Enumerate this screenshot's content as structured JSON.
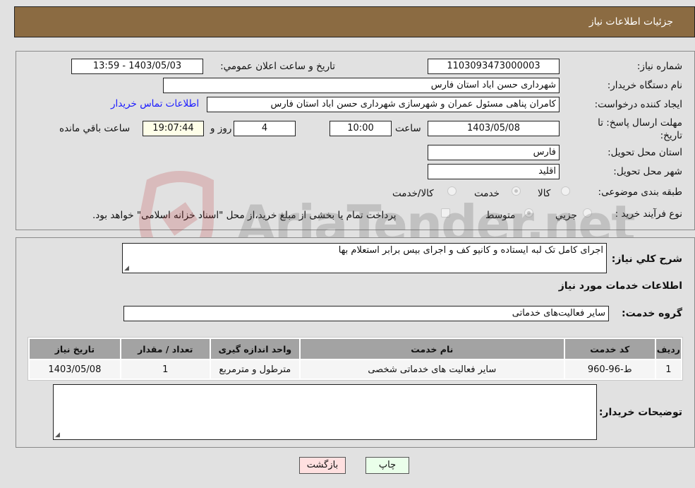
{
  "header": {
    "title": "جزئيات اطلاعات نياز"
  },
  "form": {
    "need_number_label": "شماره نياز:",
    "need_number": "1103093473000003",
    "announce_label": "تاريخ و ساعت اعلان عمومي:",
    "announce_value": "1403/05/03 - 13:59",
    "buyer_org_label": "نام دستگاه خريدار:",
    "buyer_org": "شهرداری حسن اباد استان فارس",
    "creator_label": "ايجاد کننده درخواست:",
    "creator": "کامران پناهی مسئول عمران و شهرسازی شهرداری حسن اباد استان فارس",
    "contact_link": "اطلاعات تماس خريدار",
    "deadline_label": "مهلت ارسال پاسخ: تا تاريخ:",
    "deadline_date": "1403/05/08",
    "time_label": "ساعت",
    "deadline_time": "10:00",
    "days_value": "4",
    "days_label": "روز و",
    "remaining_time": "19:07:44",
    "remaining_label": "ساعت باقي مانده",
    "province_label": "استان محل تحويل:",
    "province": "فارس",
    "city_label": "شهر محل تحويل:",
    "city": "اقليد",
    "category_label": "طبقه بندی موضوعی:",
    "category_options": [
      {
        "label": "کالا",
        "checked": false
      },
      {
        "label": "خدمت",
        "checked": true
      },
      {
        "label": "کالا/خدمت",
        "checked": false
      }
    ],
    "process_label": "نوع فرآيند خريد :",
    "process_options": [
      {
        "label": "جزيي",
        "checked": false
      },
      {
        "label": "متوسط",
        "checked": true
      }
    ],
    "treasury_note": "پرداخت تمام يا بخشی از مبلغ خريد،از محل \"اسناد خزانه اسلامی\" خواهد بود."
  },
  "details": {
    "summary_label": "شرح کلي نياز:",
    "summary": "اجرای کامل تک لبه ایستاده و کانیو کف و اجرای بیس برابر استعلام بها",
    "services_title": "اطلاعات خدمات مورد نياز",
    "service_group_label": "گروه خدمت:",
    "service_group": "ساير فعاليت‌های خدماتی",
    "table": {
      "headers": [
        "رديف",
        "کد خدمت",
        "نام خدمت",
        "واحد اندازه گيری",
        "تعداد / مقدار",
        "تاريخ نياز"
      ],
      "rows": [
        [
          "1",
          "ط-96-960",
          "ساير فعاليت های خدماتی شخصی",
          "مترطول و مترمربع",
          "1",
          "1403/05/08"
        ]
      ]
    },
    "buyer_notes_label": "توضيحات خريدار:",
    "buyer_notes": ""
  },
  "buttons": {
    "print": "چاپ",
    "back": "بازگشت"
  },
  "watermark": {
    "text": "AriaTender.net"
  },
  "colors": {
    "header": "#8b6b42",
    "print_btn": "#eaffea",
    "back_btn": "#ffe0e0",
    "link": "#1a1aff"
  }
}
